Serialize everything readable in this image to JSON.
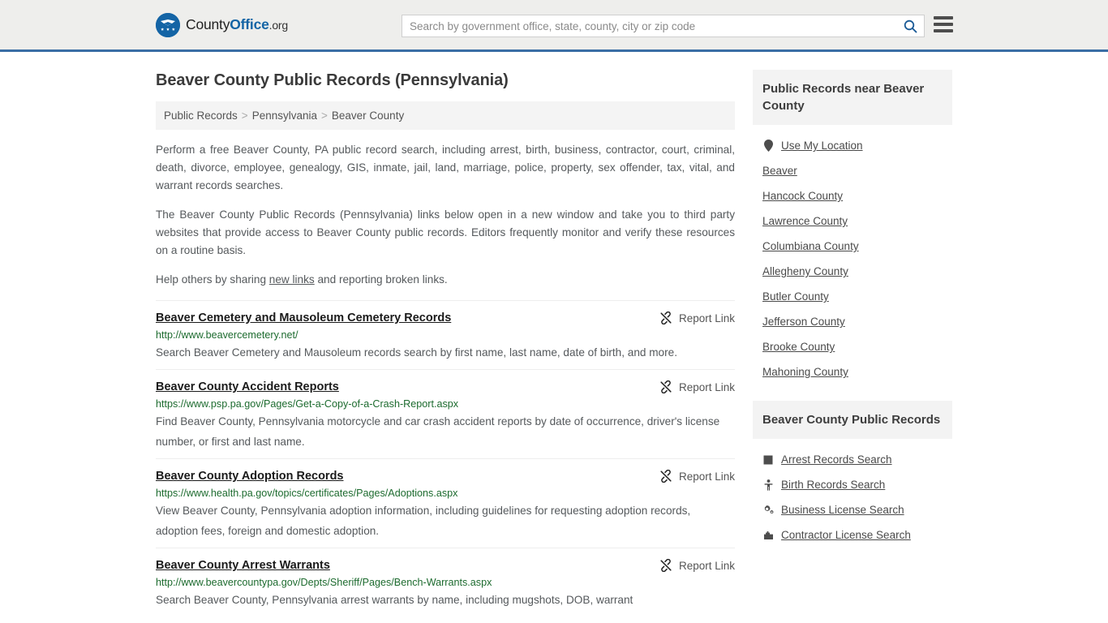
{
  "header": {
    "logo": {
      "icon": "eagle-shield-icon",
      "text_part1": "County",
      "text_part2": "Office",
      "text_part3": ".org"
    },
    "search": {
      "placeholder": "Search by government office, state, county, city or zip code",
      "value": "",
      "icon": "search-icon"
    },
    "menu_icon": "hamburger-menu-icon",
    "accent_color": "#3a6ea5",
    "background_color": "#eeeeec"
  },
  "page_title": "Beaver County Public Records (Pennsylvania)",
  "breadcrumb": {
    "items": [
      "Public Records",
      "Pennsylvania",
      "Beaver County"
    ],
    "separator": ">"
  },
  "intro": {
    "paragraph1": "Perform a free Beaver County, PA public record search, including arrest, birth, business, contractor, court, criminal, death, divorce, employee, genealogy, GIS, inmate, jail, land, marriage, police, property, sex offender, tax, vital, and warrant records searches.",
    "paragraph2": "The Beaver County Public Records (Pennsylvania) links below open in a new window and take you to third party websites that provide access to Beaver County public records. Editors frequently monitor and verify these resources on a routine basis.",
    "paragraph3_pre": "Help others by sharing ",
    "paragraph3_link": "new links",
    "paragraph3_post": " and reporting broken links."
  },
  "report_link_label": "Report Link",
  "report_link_icon": "broken-link-icon",
  "entries": [
    {
      "title": "Beaver Cemetery and Mausoleum Cemetery Records",
      "url": "http://www.beavercemetery.net/",
      "description": "Search Beaver Cemetery and Mausoleum records search by first name, last name, date of birth, and more."
    },
    {
      "title": "Beaver County Accident Reports",
      "url": "https://www.psp.pa.gov/Pages/Get-a-Copy-of-a-Crash-Report.aspx",
      "description": "Find Beaver County, Pennsylvania motorcycle and car crash accident reports by date of occurrence, driver's license number, or first and last name."
    },
    {
      "title": "Beaver County Adoption Records",
      "url": "https://www.health.pa.gov/topics/certificates/Pages/Adoptions.aspx",
      "description": "View Beaver County, Pennsylvania adoption information, including guidelines for requesting adoption records, adoption fees, foreign and domestic adoption."
    },
    {
      "title": "Beaver County Arrest Warrants",
      "url": "http://www.beavercountypa.gov/Depts/Sheriff/Pages/Bench-Warrants.aspx",
      "description": "Search Beaver County, Pennsylvania arrest warrants by name, including mugshots, DOB, warrant"
    }
  ],
  "sidebar": {
    "near_card": {
      "title": "Public Records near Beaver County",
      "items": [
        {
          "label": "Use My Location",
          "icon": "map-pin-icon"
        },
        {
          "label": "Beaver",
          "icon": ""
        },
        {
          "label": "Hancock County",
          "icon": ""
        },
        {
          "label": "Lawrence County",
          "icon": ""
        },
        {
          "label": "Columbiana County",
          "icon": ""
        },
        {
          "label": "Allegheny County",
          "icon": ""
        },
        {
          "label": "Butler County",
          "icon": ""
        },
        {
          "label": "Jefferson County",
          "icon": ""
        },
        {
          "label": "Brooke County",
          "icon": ""
        },
        {
          "label": "Mahoning County",
          "icon": ""
        }
      ]
    },
    "records_card": {
      "title": "Beaver County Public Records",
      "items": [
        {
          "label": "Arrest Records Search",
          "icon": "handcuffs-icon"
        },
        {
          "label": "Birth Records Search",
          "icon": "baby-icon"
        },
        {
          "label": "Business License Search",
          "icon": "gears-icon"
        },
        {
          "label": "Contractor License Search",
          "icon": "building-icon"
        }
      ]
    }
  }
}
